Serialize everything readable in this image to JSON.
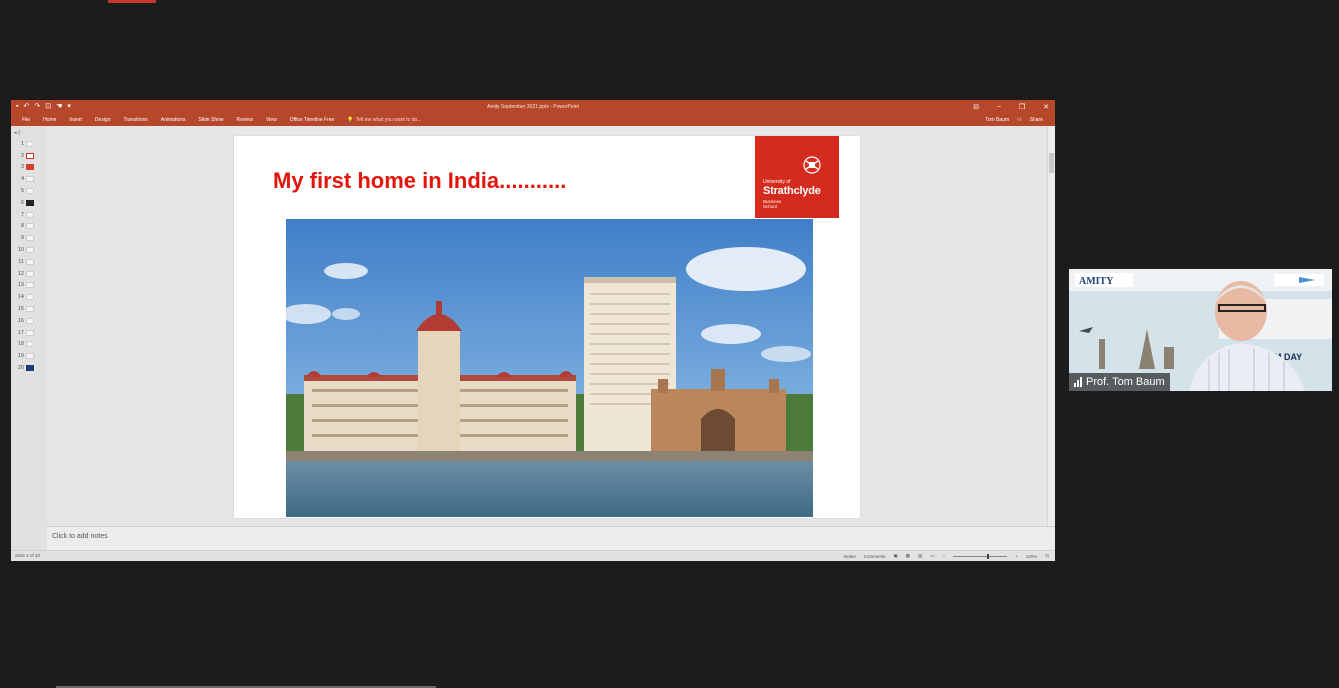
{
  "powerpoint": {
    "window_title": "Amity September 2021.pptx - PowerPoint",
    "ribbon_tabs": [
      "File",
      "Home",
      "Insert",
      "Design",
      "Transitions",
      "Animations",
      "Slide Show",
      "Review",
      "View",
      "Office Timeline Free"
    ],
    "tell_me": "Tell me what you want to do...",
    "user": "Tom Baum",
    "share": "Share",
    "thumbnails": [
      "1",
      "2",
      "3",
      "4",
      "5",
      "6",
      "7",
      "8",
      "9",
      "10",
      "11",
      "12",
      "13",
      "14",
      "15",
      "16",
      "17",
      "18",
      "19",
      "20"
    ],
    "active_slide_index": 1,
    "notes_placeholder": "Click to add notes",
    "status": {
      "slide_indicator": "Slide 2 of 20",
      "notes": "Notes",
      "comments": "Comments",
      "zoom": "120%"
    }
  },
  "slide": {
    "title": "My first home in India...........",
    "logo": {
      "university_of": "University of",
      "name": "Strathclyde",
      "business_school": "Business School"
    }
  },
  "video": {
    "participant_name": "Prof. Tom Baum",
    "bg_brand": "AMITY",
    "bg_heading": "RISM DAY"
  },
  "colors": {
    "ppt_accent": "#b7472a",
    "title_red": "#e3150a",
    "logo_red": "#d52b1e"
  }
}
